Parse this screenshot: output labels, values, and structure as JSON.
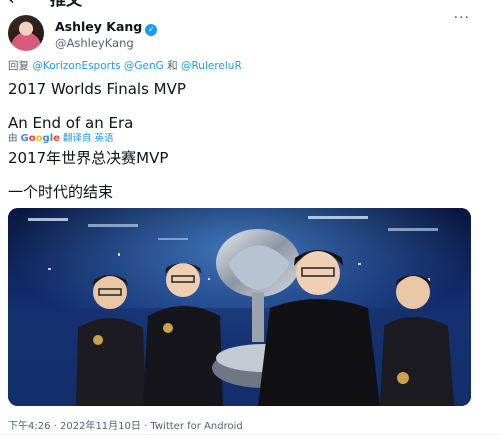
{
  "header": {
    "back_icon": "←",
    "title": "推文"
  },
  "tweet": {
    "author": {
      "display_name": "Ashley Kang",
      "verified_icon": "✓",
      "handle": "@AshleyKang"
    },
    "more_icon": "···",
    "reply": {
      "prefix": "回复",
      "mention1": "@KorizonEsports",
      "mention2": "@GenG",
      "joiner": "和",
      "mention3": "@RulereluR"
    },
    "text_line1": "2017 Worlds Finals MVP",
    "text_line2": "An End of an Era",
    "translation": {
      "prefix": "由",
      "google": [
        "G",
        "o",
        "o",
        "g",
        "l",
        "e"
      ],
      "link": "翻译自 英语"
    },
    "translated_line1": "2017年世界总决赛MVP",
    "translated_line2": "一个时代的结束",
    "meta": "下午4:26 · 2022年11月10日 · Twitter for Android"
  },
  "colors": {
    "accent": "#1d9bf0",
    "secondary_text": "#536471",
    "primary_text": "#0f1419"
  }
}
